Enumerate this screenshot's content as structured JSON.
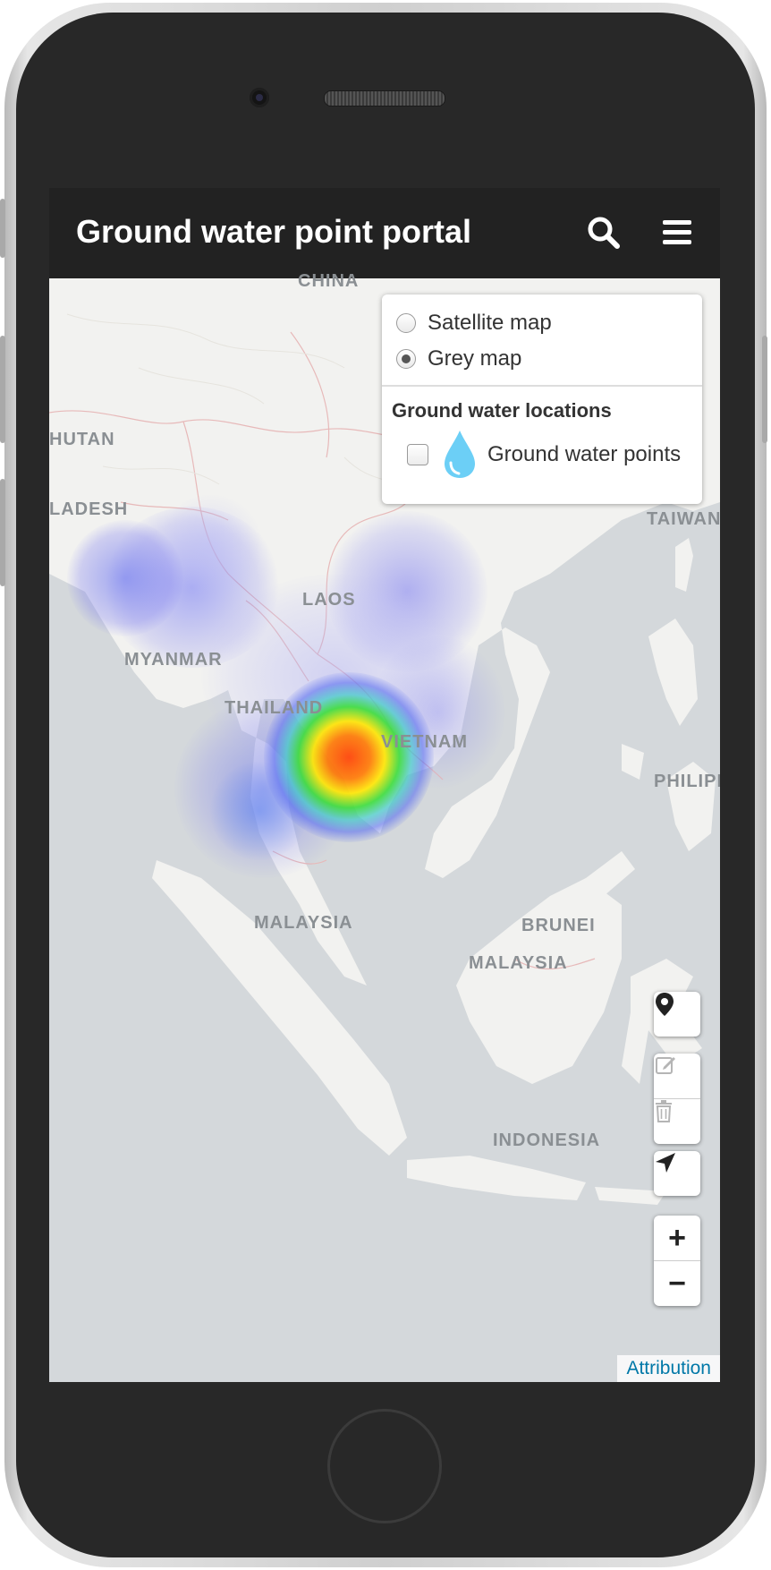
{
  "header": {
    "title": "Ground water point portal",
    "search_icon": "search-icon",
    "menu_icon": "hamburger-menu-icon"
  },
  "layer_control": {
    "base_layers": [
      {
        "label": "Satellite map",
        "selected": false
      },
      {
        "label": "Grey map",
        "selected": true
      }
    ],
    "overlay_title": "Ground water locations",
    "overlays": [
      {
        "label": "Ground water points",
        "checked": false,
        "icon": "water-drop-icon"
      }
    ]
  },
  "map": {
    "labels": {
      "china": "CHINA",
      "bhutan": "HUTAN",
      "bangladesh": "LADESH",
      "taiwan": "TAIWAN",
      "laos": "LAOS",
      "myanmar": "MYANMAR",
      "thailand": "THAILAND",
      "vietnam": "VIETNAM",
      "philippines": "PHILIPPINES",
      "malaysia_west": "MALAYSIA",
      "brunei": "BRUNEI",
      "malaysia_east": "MALAYSIA",
      "indonesia": "INDONESIA"
    },
    "attribution": "Attribution",
    "zoom_in": "+",
    "zoom_out": "−"
  },
  "controls": {
    "marker": "map-marker-icon",
    "edit": "edit-icon",
    "delete": "trash-icon",
    "locate": "navigation-arrow-icon"
  },
  "colors": {
    "navbar": "#222222",
    "map_water": "#d4d8db",
    "land": "#f2f2f0",
    "border": "#e7b9b9",
    "attribution_link": "#0078a8",
    "heat_low": "#6a6ff0",
    "heat_mid": "#3ddc3d",
    "heat_high": "#ff4a0a"
  }
}
